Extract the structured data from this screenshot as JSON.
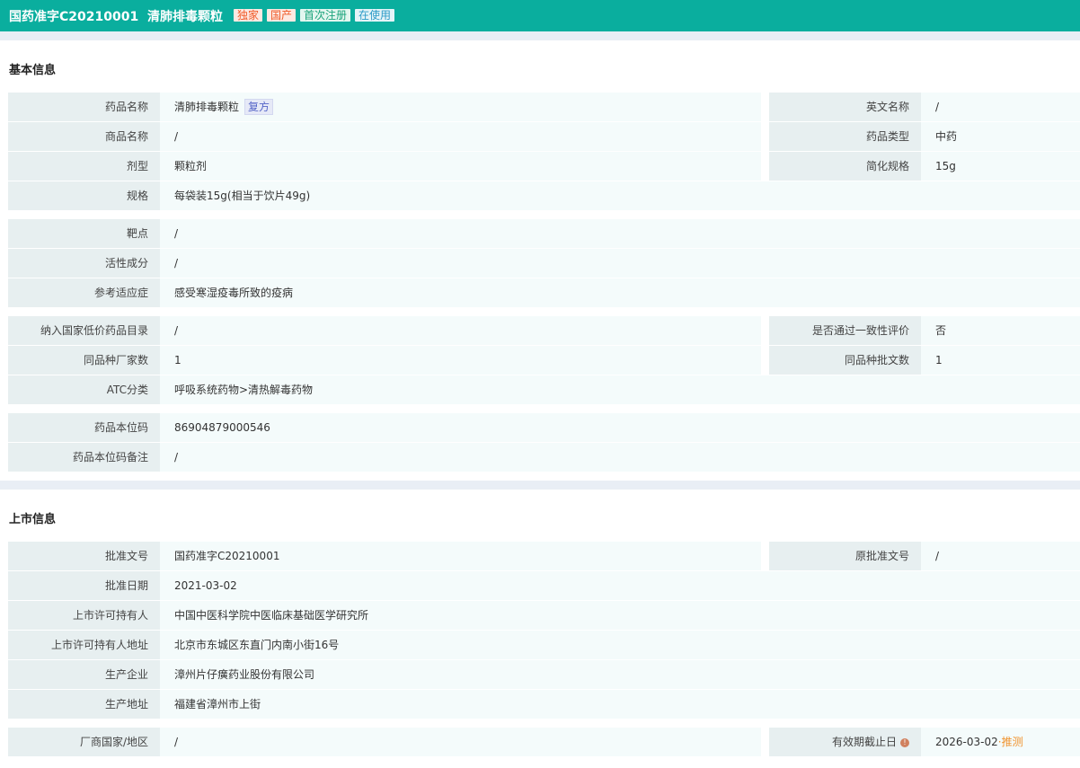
{
  "header": {
    "title": "国药准字C20210001  清肺排毒颗粒",
    "tags": [
      {
        "label": "独家",
        "color": "orange"
      },
      {
        "label": "国产",
        "color": "orange"
      },
      {
        "label": "首次注册",
        "color": "green"
      },
      {
        "label": "在使用",
        "color": "blue"
      }
    ]
  },
  "sections": [
    {
      "title": "基本信息",
      "groups": [
        [
          {
            "l": "药品名称",
            "v": "清肺排毒颗粒",
            "badge": "复方",
            "rl": "英文名称",
            "rv": "/"
          },
          {
            "l": "商品名称",
            "v": "/",
            "rl": "药品类型",
            "rv": "中药"
          },
          {
            "l": "剂型",
            "v": "颗粒剂",
            "rl": "简化规格",
            "rv": "15g"
          },
          {
            "l": "规格",
            "v": "每袋装15g(相当于饮片49g)"
          }
        ],
        [
          {
            "l": "靶点",
            "v": "/"
          },
          {
            "l": "活性成分",
            "v": "/"
          },
          {
            "l": "参考适应症",
            "v": "感受寒湿疫毒所致的疫病"
          }
        ],
        [
          {
            "l": "纳入国家低价药品目录",
            "v": "/",
            "rl": "是否通过一致性评价",
            "rv": "否"
          },
          {
            "l": "同品种厂家数",
            "v": "1",
            "rl": "同品种批文数",
            "rv": "1"
          },
          {
            "l": "ATC分类",
            "v": "呼吸系统药物>清热解毒药物"
          }
        ],
        [
          {
            "l": "药品本位码",
            "v": "86904879000546"
          },
          {
            "l": "药品本位码备注",
            "v": "/"
          }
        ]
      ]
    },
    {
      "title": "上市信息",
      "groups": [
        [
          {
            "l": "批准文号",
            "v": "国药准字C20210001",
            "rl": "原批准文号",
            "rv": "/"
          },
          {
            "l": "批准日期",
            "v": "2021-03-02"
          },
          {
            "l": "上市许可持有人",
            "v": "中国中医科学院中医临床基础医学研究所"
          },
          {
            "l": "上市许可持有人地址",
            "v": "北京市东城区东直门内南小街16号"
          },
          {
            "l": "生产企业",
            "v": "漳州片仔癀药业股份有限公司"
          },
          {
            "l": "生产地址",
            "v": "福建省漳州市上街"
          }
        ],
        [
          {
            "l": "厂商国家/地区",
            "v": "/",
            "rl": "有效期截止日",
            "rv": "2026-03-02",
            "info": true,
            "suffix": "·推测"
          }
        ]
      ]
    }
  ]
}
